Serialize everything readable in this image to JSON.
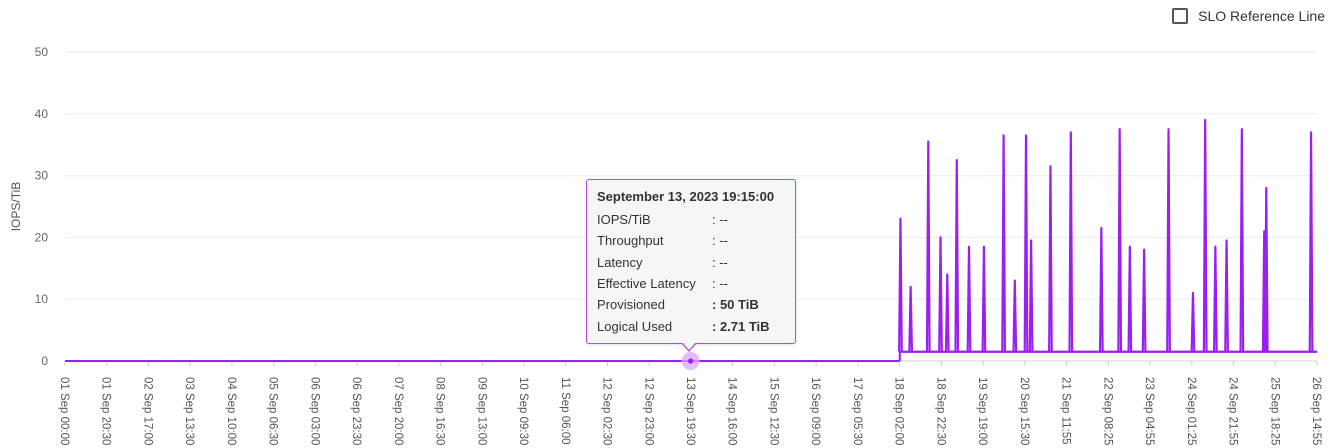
{
  "slo": {
    "label": "SLO Reference Line",
    "checked": false
  },
  "tooltip": {
    "title": "September 13, 2023 19:15:00",
    "rows": [
      {
        "label": "IOPS/TiB",
        "value": ": --",
        "bold": false
      },
      {
        "label": "Throughput",
        "value": ": --",
        "bold": false
      },
      {
        "label": "Latency",
        "value": ": --",
        "bold": false
      },
      {
        "label": "Effective Latency",
        "value": ": --",
        "bold": false
      },
      {
        "label": "Provisioned",
        "value": ": 50 TiB",
        "bold": true
      },
      {
        "label": "Logical Used",
        "value": ": 2.71 TiB",
        "bold": true
      }
    ]
  },
  "colors": {
    "series": "#9a1ff0",
    "marker": "#d9a6f7",
    "tooltip_border": "#b54de0",
    "grid": "#ebebeb"
  },
  "chart_data": {
    "type": "line",
    "ylabel": "IOPS/TiB",
    "ylim": [
      0,
      50
    ],
    "yticks": [
      "0",
      "10",
      "20",
      "30",
      "40",
      "50"
    ],
    "grid": true,
    "x_tick_labels": [
      "01 Sep 00:00",
      "01 Sep 20:30",
      "02 Sep 17:00",
      "03 Sep 13:30",
      "04 Sep 10:00",
      "05 Sep 06:30",
      "06 Sep 03:00",
      "06 Sep 23:30",
      "07 Sep 20:00",
      "08 Sep 16:30",
      "09 Sep 13:00",
      "10 Sep 09:30",
      "11 Sep 06:00",
      "12 Sep 02:30",
      "12 Sep 23:00",
      "13 Sep 19:30",
      "14 Sep 16:00",
      "15 Sep 12:30",
      "16 Sep 09:00",
      "17 Sep 05:30",
      "18 Sep 02:00",
      "18 Sep 22:30",
      "19 Sep 19:00",
      "20 Sep 15:30",
      "21 Sep 11:55",
      "22 Sep 08:25",
      "23 Sep 04:55",
      "24 Sep 01:25",
      "24 Sep 21:55",
      "25 Sep 18:25",
      "26 Sep 14:55"
    ],
    "x_range": [
      "2023-09-01 00:00",
      "2023-09-26 14:55"
    ],
    "baseline": {
      "x_start": "2023-09-01 00:00",
      "x_end": "2023-09-18 02:00",
      "y": 0
    },
    "active_level": 1.5,
    "spikes": [
      {
        "x": "2023-09-18 02:20",
        "y": 23
      },
      {
        "x": "2023-09-18 07:20",
        "y": 12
      },
      {
        "x": "2023-09-18 16:00",
        "y": 35.5
      },
      {
        "x": "2023-09-18 22:00",
        "y": 20
      },
      {
        "x": "2023-09-19 01:20",
        "y": 14
      },
      {
        "x": "2023-09-19 06:00",
        "y": 32.5
      },
      {
        "x": "2023-09-19 12:00",
        "y": 18.5
      },
      {
        "x": "2023-09-19 19:20",
        "y": 18.5
      },
      {
        "x": "2023-09-20 05:00",
        "y": 36.5
      },
      {
        "x": "2023-09-20 10:30",
        "y": 13
      },
      {
        "x": "2023-09-20 16:00",
        "y": 36.5
      },
      {
        "x": "2023-09-20 18:30",
        "y": 19.5
      },
      {
        "x": "2023-09-21 04:00",
        "y": 31.5
      },
      {
        "x": "2023-09-21 14:00",
        "y": 37
      },
      {
        "x": "2023-09-22 05:00",
        "y": 21.5
      },
      {
        "x": "2023-09-22 14:00",
        "y": 37.5
      },
      {
        "x": "2023-09-22 19:00",
        "y": 18.5
      },
      {
        "x": "2023-09-23 02:00",
        "y": 18
      },
      {
        "x": "2023-09-23 14:00",
        "y": 37.5
      },
      {
        "x": "2023-09-24 02:00",
        "y": 11
      },
      {
        "x": "2023-09-24 08:00",
        "y": 39
      },
      {
        "x": "2023-09-24 13:00",
        "y": 18.5
      },
      {
        "x": "2023-09-24 18:30",
        "y": 19.5
      },
      {
        "x": "2023-09-25 02:00",
        "y": 37.5
      },
      {
        "x": "2023-09-25 13:00",
        "y": 21
      },
      {
        "x": "2023-09-25 14:00",
        "y": 28
      },
      {
        "x": "2023-09-26 12:00",
        "y": 37
      }
    ],
    "highlight_point": {
      "x": "2023-09-13 19:15",
      "y": 0
    }
  }
}
